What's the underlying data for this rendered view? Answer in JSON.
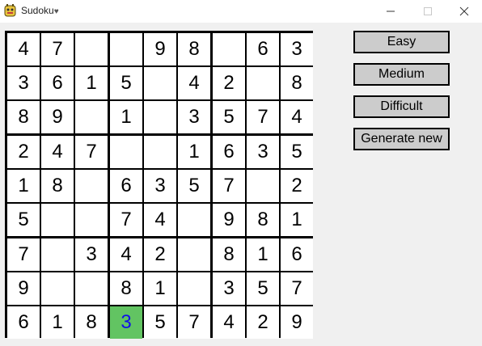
{
  "window": {
    "title": "Sudoku",
    "title_icon": "heart-icon",
    "app_icon": "python-icon",
    "controls": [
      "minimize-icon",
      "maximize-icon",
      "close-icon"
    ]
  },
  "menu": {
    "easy": "Easy",
    "medium": "Medium",
    "difficult": "Difficult",
    "generate": "Generate new"
  },
  "board": {
    "grid": [
      [
        "4",
        "7",
        "",
        "",
        "9",
        "8",
        "",
        "6",
        "3"
      ],
      [
        "3",
        "6",
        "1",
        "5",
        "",
        "4",
        "2",
        "",
        "8"
      ],
      [
        "8",
        "9",
        "",
        "1",
        "",
        "3",
        "5",
        "7",
        "4"
      ],
      [
        "2",
        "4",
        "7",
        "",
        "",
        "1",
        "6",
        "3",
        "5"
      ],
      [
        "1",
        "8",
        "",
        "6",
        "3",
        "5",
        "7",
        "",
        "2"
      ],
      [
        "5",
        "",
        "",
        "7",
        "4",
        "",
        "9",
        "8",
        "1"
      ],
      [
        "7",
        "",
        "3",
        "4",
        "2",
        "",
        "8",
        "1",
        "6"
      ],
      [
        "9",
        "",
        "",
        "8",
        "1",
        "",
        "3",
        "5",
        "7"
      ],
      [
        "6",
        "1",
        "8",
        "3",
        "5",
        "7",
        "4",
        "2",
        "9"
      ]
    ],
    "selected": {
      "row": 8,
      "col": 3
    }
  },
  "colors": {
    "selected_bg": "#62c462",
    "selected_text": "#1010e8",
    "button_bg": "#cccccc",
    "client_bg": "#f0f0f0"
  }
}
